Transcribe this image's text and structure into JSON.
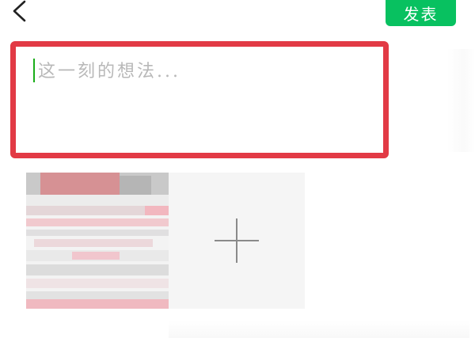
{
  "header": {
    "back_icon": "chevron-left-icon",
    "publish_label": "发表",
    "accent_color": "#08c160"
  },
  "composer": {
    "placeholder": "这一刻的想法...",
    "value": "",
    "highlight_color": "#e23a45"
  },
  "media": {
    "add_icon": "plus-icon"
  }
}
